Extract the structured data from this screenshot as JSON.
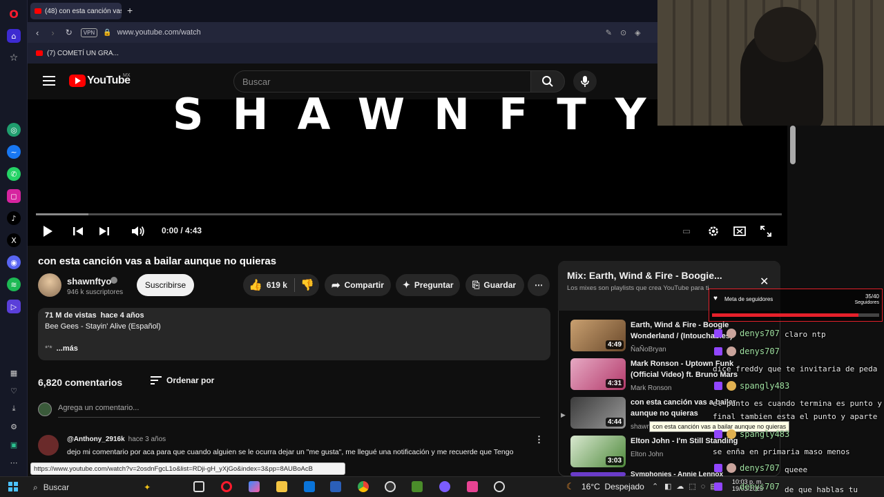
{
  "browser": {
    "tab_title": "(48) con esta canción vas",
    "url": "www.youtube.com/watch",
    "vpn_label": "VPN",
    "bookmark": "(7) COMETÍ UN GRA..."
  },
  "youtube": {
    "logo_text": "YouTube",
    "country_code": "MX",
    "search_placeholder": "Buscar"
  },
  "player": {
    "overlay_text": "SHAWNFTYO",
    "time": "0:00 / 4:43",
    "progress_fraction": 0.0
  },
  "video": {
    "title": "con esta canción vas a bailar aunque no quieras",
    "channel": "shawnftyo",
    "subscribers": "946 k suscriptores",
    "subscribe_label": "Suscribirse",
    "likes": "619 k",
    "share_label": "Compartir",
    "ask_label": "Preguntar",
    "save_label": "Guardar",
    "views": "71 M de vistas",
    "age": "hace 4 años",
    "description_line": "Bee Gees - Stayin' Alive (Español)",
    "description_more_prefix": "*'*",
    "description_more": "...más"
  },
  "comments": {
    "count_label": "6,820 comentarios",
    "sort_label": "Ordenar por",
    "add_placeholder": "Agrega un comentario...",
    "first": {
      "author": "@Anthony_2916k",
      "age": "hace 3 años",
      "text": "dejo mi comentario por aca para que cuando alguien se le ocurra dejar un \"me gusta\", me llegué una notificación y me recuerde que Tengo"
    }
  },
  "status_url": "https://www.youtube.com/watch?v=2osdnFgcL1o&list=RDji-gH_yXjGo&index=3&pp=8AUBoAcB",
  "playlist": {
    "title": "Mix: Earth, Wind & Fire - Boogie...",
    "subtitle": "Los mixes son playlists que crea YouTube para ti",
    "items": [
      {
        "title": "Earth, Wind & Fire - Boogie Wonderland / (Intouchables)",
        "channel": "ÑaÑoBryan",
        "duration": "4:49"
      },
      {
        "title": "Mark Ronson - Uptown Funk (Official Video) ft. Bruno Mars",
        "channel": "Mark Ronson",
        "duration": "4:31"
      },
      {
        "title": "con esta canción vas a bailar aunque no quieras",
        "channel": "shawnftyo",
        "duration": "4:44"
      },
      {
        "title": "Elton John - I'm Still Standing",
        "channel": "Elton John",
        "duration": "3:03"
      },
      {
        "title": "Symphonies - Annie Lennox",
        "channel": "",
        "duration": ""
      }
    ],
    "tooltip": "con esta canción vas a bailar aunque no quieras"
  },
  "follower_goal": {
    "label": "Meta de seguidores",
    "count": "35/40",
    "unit": "Seguidores",
    "fraction": 0.875
  },
  "chat": [
    {
      "user": "denys707",
      "msg": "claro ntp"
    },
    {
      "user": "denys707",
      "msg": ""
    },
    {
      "user": "",
      "msg": "dice freddy que te invitaria de peda"
    },
    {
      "user": "spangly483",
      "msg": ""
    },
    {
      "user": "",
      "msg": "el punto es cuando termina es punto y"
    },
    {
      "user": "",
      "msg": "final tambien esta el punto y aparte"
    },
    {
      "user": "spangly483",
      "msg": ""
    },
    {
      "user": "",
      "msg": "se enña en primaria maso menos"
    },
    {
      "user": "denys707",
      "msg": "queee"
    },
    {
      "user": "denys707",
      "msg": "de que hablas tu"
    }
  ],
  "taskbar": {
    "search_label": "Buscar",
    "weather": "16°C  Despejado",
    "clock_time": "10:03 p. m.",
    "clock_date": "19/03/2025"
  },
  "colors": {
    "youtube_red": "#ff0000",
    "twitch_purple": "#9146ff",
    "goal_red": "#e5202a"
  }
}
